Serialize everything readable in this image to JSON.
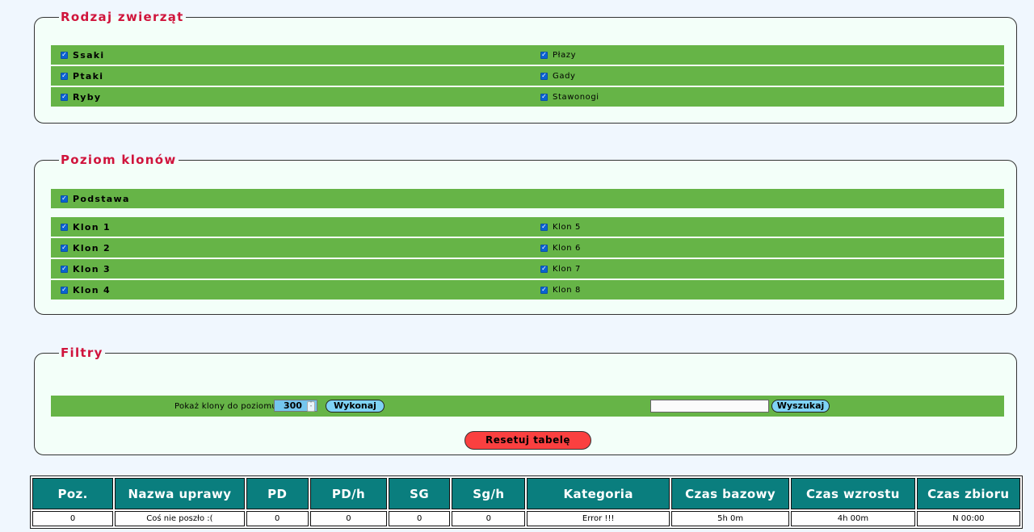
{
  "animal_section": {
    "title": "Rodzaj zwierząt",
    "left": [
      "Ssaki",
      "Ptaki",
      "Ryby"
    ],
    "right": [
      "Płazy",
      "Gady",
      "Stawonogi"
    ]
  },
  "clone_section": {
    "title": "Poziom klonów",
    "base": "Podstawa",
    "left": [
      "Klon 1",
      "Klon 2",
      "Klon 3",
      "Klon 4"
    ],
    "right": [
      "Klon 5",
      "Klon 6",
      "Klon 7",
      "Klon 8"
    ]
  },
  "filters": {
    "title": "Filtry",
    "level_label": "Pokaż klony do poziomu:",
    "level_value": "300",
    "execute_label": "Wykonaj",
    "search_value": "",
    "search_label": "Wyszukaj",
    "reset_label": "Resetuj tabelę"
  },
  "table": {
    "headers": [
      "Poz.",
      "Nazwa uprawy",
      "PD",
      "PD/h",
      "SG",
      "Sg/h",
      "Kategoria",
      "Czas bazowy",
      "Czas wzrostu",
      "Czas zbioru"
    ],
    "rows": [
      [
        "0",
        "Coś nie poszło :(",
        "0",
        "0",
        "0",
        "0",
        "Error !!!",
        "5h 0m",
        "4h 00m",
        "N 00:00"
      ]
    ]
  },
  "colors": {
    "row_green": "#66b447",
    "legend_red": "#d0143c",
    "header_teal": "#0a7e7e",
    "button_blue": "#7fd3f5",
    "reset_red": "#fa4040"
  },
  "icons": {
    "checkbox": "checkbox-checked-icon",
    "spinner": "spinner-arrows-icon"
  }
}
